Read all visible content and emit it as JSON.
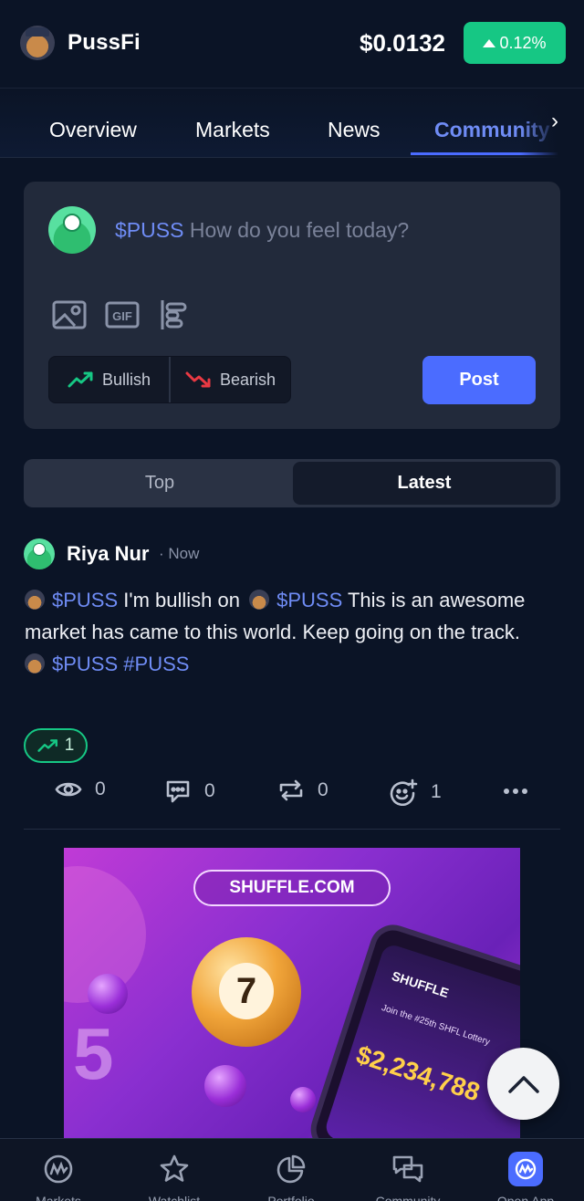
{
  "header": {
    "coin_name": "PussFi",
    "price": "$0.0132",
    "change": "0.12%",
    "change_color": "#16c784"
  },
  "tabs": [
    {
      "label": "Overview"
    },
    {
      "label": "Markets"
    },
    {
      "label": "News"
    },
    {
      "label": "Community",
      "active": true
    }
  ],
  "composer": {
    "ticker": "$PUSS",
    "placeholder": "How do you feel today?",
    "bullish_label": "Bullish",
    "bearish_label": "Bearish",
    "post_label": "Post",
    "tool_gif_label": "GIF"
  },
  "feed_toggle": {
    "top_label": "Top",
    "latest_label": "Latest"
  },
  "post": {
    "author": "Riya Nur",
    "time": "· Now",
    "tag": "$PUSS",
    "text_1": "I'm bullish on",
    "text_2": "This is an awesome market has came to this world. Keep going on the track.",
    "hashtag": "#PUSS",
    "bullish_votes": "1",
    "views": "0",
    "comments": "0",
    "reposts": "0",
    "reactions": "1"
  },
  "ad": {
    "brand": "SHUFFLE.COM",
    "ball_number": "7",
    "side_number": "5",
    "phone_brand": "SHUFFLE",
    "phone_text": "Join the #25th SHFL Lottery",
    "phone_amount": "$2,234,788"
  },
  "bottom_nav": [
    {
      "label": "Markets"
    },
    {
      "label": "Watchlist"
    },
    {
      "label": "Portfolio"
    },
    {
      "label": "Community"
    },
    {
      "label": "Open App",
      "active": true
    }
  ],
  "colors": {
    "accent": "#4b6cff",
    "link": "#6f8cf5",
    "bullish": "#16c784",
    "bearish": "#ea3943",
    "background": "#0b1426"
  }
}
